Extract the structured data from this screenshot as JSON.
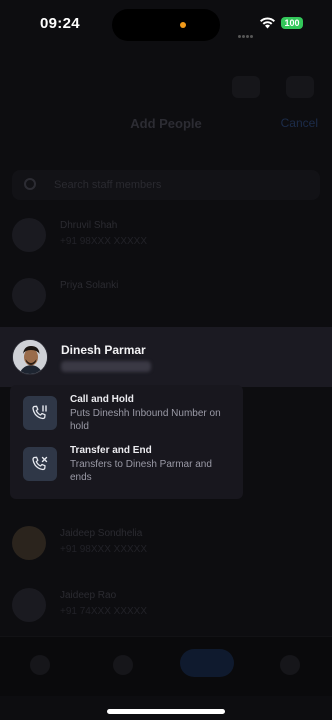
{
  "status_bar": {
    "time": "09:24",
    "battery": "100",
    "battery_color": "#33c75a"
  },
  "background": {
    "title": "Add People",
    "cancel_label": "Cancel",
    "search_placeholder": "Search staff members",
    "rows": [
      {
        "name": "Dhruvil Shah",
        "sub": "+91 98XXX XXXXX"
      },
      {
        "name": "Priya Solanki",
        "sub": ""
      },
      {
        "name": "Jaideep Sondhelia",
        "sub": "+91 98XXX XXXXX"
      },
      {
        "name": "Jaideep Rao",
        "sub": "+91 74XXX XXXXX"
      }
    ]
  },
  "contact": {
    "name": "Dinesh Parmar"
  },
  "menu": {
    "items": [
      {
        "title": "Call and Hold",
        "description": "Puts Dineshh Inbound Number on hold",
        "icon": "phone-pause-icon"
      },
      {
        "title": "Transfer and End",
        "description": "Transfers to Dinesh Parmar and ends",
        "icon": "phone-x-icon"
      }
    ]
  },
  "colors": {
    "menu_icon_bg": "#2f3747",
    "accent": "#33c75a"
  }
}
